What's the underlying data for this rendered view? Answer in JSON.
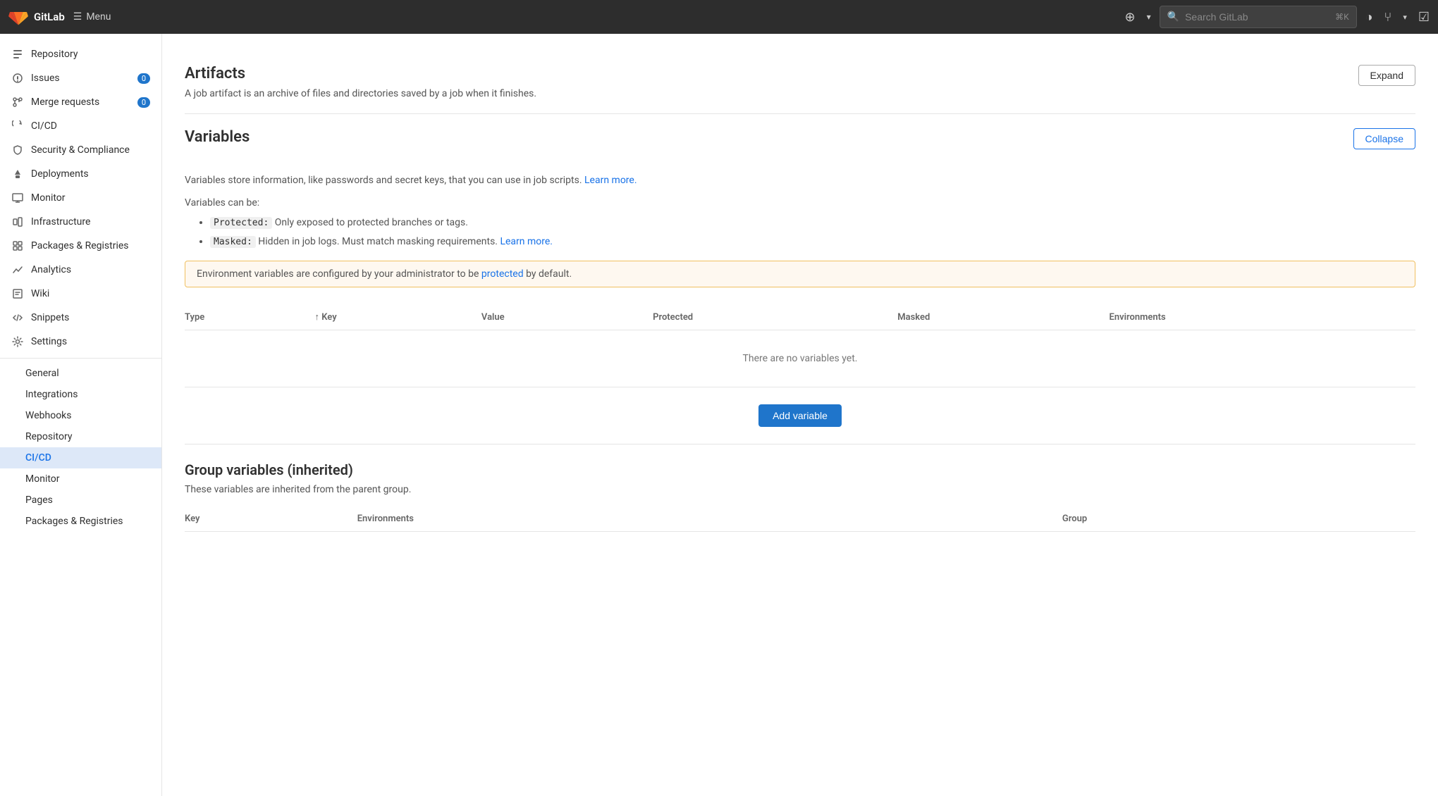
{
  "topnav": {
    "logo_text": "GitLab",
    "menu_label": "Menu",
    "search_placeholder": "Search GitLab"
  },
  "sidebar": {
    "items": [
      {
        "id": "repository",
        "label": "Repository",
        "icon": "repo"
      },
      {
        "id": "issues",
        "label": "Issues",
        "icon": "issues",
        "badge": "0"
      },
      {
        "id": "merge-requests",
        "label": "Merge requests",
        "icon": "merge",
        "badge": "0"
      },
      {
        "id": "cicd",
        "label": "CI/CD",
        "icon": "cicd"
      },
      {
        "id": "security",
        "label": "Security & Compliance",
        "icon": "shield"
      },
      {
        "id": "deployments",
        "label": "Deployments",
        "icon": "deploy"
      },
      {
        "id": "monitor",
        "label": "Monitor",
        "icon": "monitor"
      },
      {
        "id": "infrastructure",
        "label": "Infrastructure",
        "icon": "infra"
      },
      {
        "id": "packages",
        "label": "Packages & Registries",
        "icon": "package"
      },
      {
        "id": "analytics",
        "label": "Analytics",
        "icon": "analytics"
      },
      {
        "id": "wiki",
        "label": "Wiki",
        "icon": "wiki"
      },
      {
        "id": "snippets",
        "label": "Snippets",
        "icon": "snippets"
      },
      {
        "id": "settings",
        "label": "Settings",
        "icon": "settings"
      }
    ],
    "sub_items": [
      {
        "id": "general",
        "label": "General"
      },
      {
        "id": "integrations",
        "label": "Integrations"
      },
      {
        "id": "webhooks",
        "label": "Webhooks"
      },
      {
        "id": "repository-sub",
        "label": "Repository"
      },
      {
        "id": "cicd-sub",
        "label": "CI/CD",
        "active": true
      },
      {
        "id": "monitor-sub",
        "label": "Monitor"
      },
      {
        "id": "pages",
        "label": "Pages"
      },
      {
        "id": "packages-sub",
        "label": "Packages & Registries"
      }
    ]
  },
  "artifacts": {
    "title": "Artifacts",
    "description": "A job artifact is an archive of files and directories saved by a job when it finishes.",
    "expand_label": "Expand"
  },
  "variables": {
    "title": "Variables",
    "collapse_label": "Collapse",
    "description": "Variables store information, like passwords and secret keys, that you can use in job scripts.",
    "learn_more_link": "Learn more.",
    "list_intro": "Variables can be:",
    "bullets": [
      {
        "code": "Protected:",
        "text": " Only exposed to protected branches or tags."
      },
      {
        "code": "Masked:",
        "text": " Hidden in job logs. Must match masking requirements.",
        "link": "Learn more."
      }
    ],
    "alert_text": "Environment variables are configured by your administrator to be",
    "alert_link": "protected",
    "alert_suffix": " by default.",
    "table_headers": [
      "Type",
      "Key",
      "Value",
      "Protected",
      "Masked",
      "Environments"
    ],
    "key_sort_icon": "↑",
    "empty_message": "There are no variables yet.",
    "add_variable_label": "Add variable"
  },
  "group_variables": {
    "title": "Group variables (inherited)",
    "description": "These variables are inherited from the parent group.",
    "table_headers": [
      "Key",
      "Environments",
      "Group"
    ]
  }
}
